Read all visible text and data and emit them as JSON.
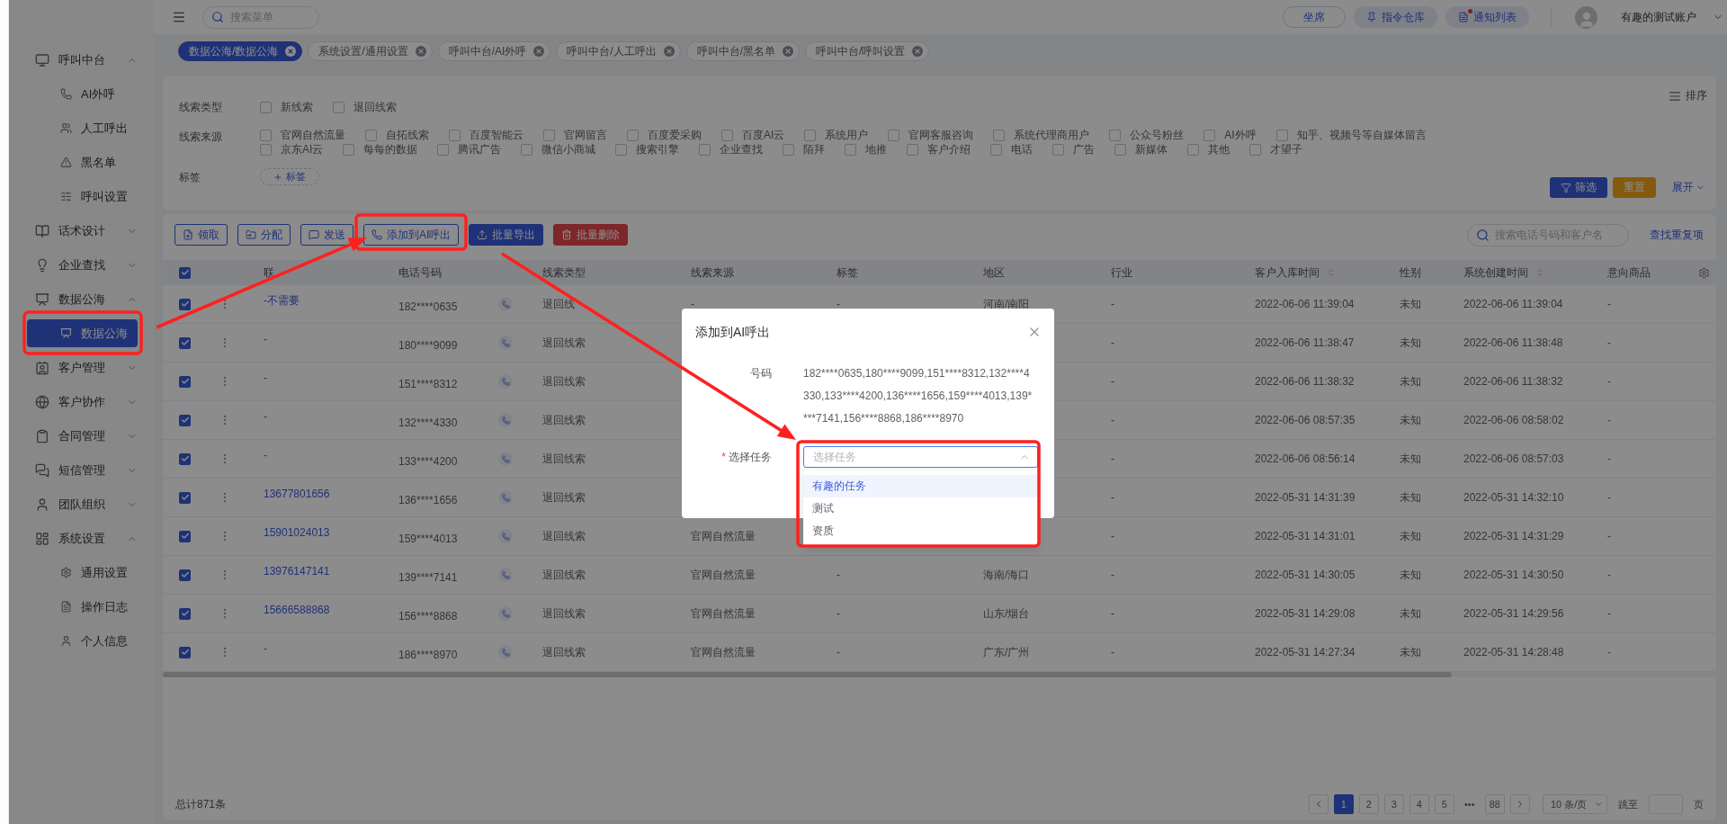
{
  "top_bar": {
    "search": {
      "placeholder": "搜索菜单"
    },
    "buttons": [
      {
        "label": "坐席",
        "kind": "outline",
        "dot": false
      },
      {
        "label": "指令仓库",
        "kind": "soft",
        "dot": false
      },
      {
        "label": "通知列表",
        "kind": "soft",
        "dot": true
      }
    ],
    "user": {
      "name": "有趣的测试账户"
    }
  },
  "sidebar": {
    "items": [
      {
        "label": "呼叫中台",
        "expanded": true,
        "children": [
          {
            "label": "AI外呼",
            "selected": false
          },
          {
            "label": "人工呼出",
            "selected": false
          },
          {
            "label": "黑名单",
            "selected": false
          },
          {
            "label": "呼叫设置",
            "selected": false
          }
        ]
      },
      {
        "label": "话术设计",
        "expanded": false
      },
      {
        "label": "企业查找",
        "expanded": false
      },
      {
        "label": "数据公海",
        "expanded": true,
        "children": [
          {
            "label": "数据公海",
            "selected": true
          }
        ]
      },
      {
        "label": "客户管理",
        "expanded": false
      },
      {
        "label": "客户协作",
        "expanded": false
      },
      {
        "label": "合同管理",
        "expanded": false
      },
      {
        "label": "短信管理",
        "expanded": false
      },
      {
        "label": "团队组织",
        "expanded": false
      },
      {
        "label": "系统设置",
        "expanded": true,
        "children": [
          {
            "label": "通用设置",
            "selected": false
          },
          {
            "label": "操作日志",
            "selected": false
          },
          {
            "label": "个人信息",
            "selected": false
          }
        ]
      }
    ]
  },
  "tabs": [
    {
      "label": "数据公海/数据公海",
      "selected": true
    },
    {
      "label": "系统设置/通用设置",
      "selected": false
    },
    {
      "label": "呼叫中台/AI外呼",
      "selected": false
    },
    {
      "label": "呼叫中台/人工呼出",
      "selected": false
    },
    {
      "label": "呼叫中台/黑名单",
      "selected": false
    },
    {
      "label": "呼叫中台/呼叫设置",
      "selected": false
    }
  ],
  "filters": {
    "sort_label": "排序",
    "groups": [
      {
        "label": "线索类型",
        "kind": "checkboxes",
        "option_rows": [
          [
            {
              "label": "新线索",
              "checked": false
            },
            {
              "label": "退回线索",
              "checked": false
            }
          ]
        ]
      },
      {
        "label": "线索来源",
        "kind": "checkboxes",
        "option_rows": [
          [
            {
              "label": "官网自然流量",
              "checked": false
            },
            {
              "label": "自拓线索",
              "checked": false
            },
            {
              "label": "百度智能云",
              "checked": false
            },
            {
              "label": "官网留言",
              "checked": false
            },
            {
              "label": "百度爱采购",
              "checked": false
            },
            {
              "label": "百度AI云",
              "checked": false
            },
            {
              "label": "系统用户",
              "checked": false
            },
            {
              "label": "官网客服咨询",
              "checked": false
            },
            {
              "label": "系统代理商用户",
              "checked": false
            },
            {
              "label": "公众号粉丝",
              "checked": false
            },
            {
              "label": "AI外呼",
              "checked": false
            },
            {
              "label": "知乎、视频号等自媒体留言",
              "checked": false
            }
          ],
          [
            {
              "label": "京东AI云",
              "checked": false
            },
            {
              "label": "每每的数据",
              "checked": false
            },
            {
              "label": "腾讯广告",
              "checked": false
            },
            {
              "label": "微信小商城",
              "checked": false
            },
            {
              "label": "搜索引擎",
              "checked": false
            },
            {
              "label": "企业查找",
              "checked": false
            },
            {
              "label": "陌拜",
              "checked": false
            },
            {
              "label": "地推",
              "checked": false
            },
            {
              "label": "客户介绍",
              "checked": false
            },
            {
              "label": "电话",
              "checked": false
            },
            {
              "label": "广告",
              "checked": false
            },
            {
              "label": "新媒体",
              "checked": false
            },
            {
              "label": "其他",
              "checked": false
            },
            {
              "label": "才望子",
              "checked": false
            }
          ]
        ]
      },
      {
        "label": "标签",
        "kind": "add_tag",
        "button": "标签"
      }
    ],
    "actions": [
      {
        "label": "筛选",
        "kind": "primary"
      },
      {
        "label": "重置",
        "kind": "warning"
      }
    ],
    "expand_link": "展开"
  },
  "toolbar": {
    "buttons": [
      {
        "label": "领取",
        "kind": "outline"
      },
      {
        "label": "分配",
        "kind": "outline"
      },
      {
        "label": "发送",
        "kind": "outline"
      },
      {
        "label": "添加到AI呼出",
        "kind": "outline"
      },
      {
        "label": "批量导出",
        "kind": "primary"
      },
      {
        "label": "批量删除",
        "kind": "danger"
      }
    ],
    "search": {
      "placeholder": "搜索电话号码和客户名"
    },
    "link": "查找重复项"
  },
  "table": {
    "all_checked": true,
    "columns": [
      {
        "label": "联",
        "sortable": false
      },
      {
        "label": "电话号码",
        "sortable": false
      },
      {
        "label": "线索类型",
        "sortable": false
      },
      {
        "label": "线索来源",
        "sortable": false
      },
      {
        "label": "标签",
        "sortable": false
      },
      {
        "label": "地区",
        "sortable": false
      },
      {
        "label": "行业",
        "sortable": false
      },
      {
        "label": "客户入库时间",
        "sortable": true
      },
      {
        "label": "性别",
        "sortable": false
      },
      {
        "label": "系统创建时间",
        "sortable": true
      },
      {
        "label": "意向商品",
        "sortable": false
      }
    ],
    "rows": [
      {
        "checked": true,
        "contact": "-不需要",
        "phone": "182****0635",
        "lead_type": "退回线",
        "lead_source": "-",
        "tag": "-",
        "region": "河南/南阳",
        "industry": "-",
        "in_time": "2022-06-06 11:39:04",
        "gender": "未知",
        "created_time": "2022-06-06 11:39:04",
        "product": "-"
      },
      {
        "checked": true,
        "contact": "-",
        "phone": "180****9099",
        "lead_type": "退回线索",
        "industry": "-",
        "in_time": "2022-06-06 11:38:47",
        "gender": "未知",
        "created_time": "2022-06-06 11:38:48",
        "product": "-"
      },
      {
        "checked": true,
        "contact": "-",
        "phone": "151****8312",
        "lead_type": "退回线索",
        "industry": "-",
        "in_time": "2022-06-06 11:38:32",
        "gender": "未知",
        "created_time": "2022-06-06 11:38:32",
        "product": "-"
      },
      {
        "checked": true,
        "contact": "-",
        "phone": "132****4330",
        "lead_type": "退回线索",
        "industry": "-",
        "in_time": "2022-06-06 08:57:35",
        "gender": "未知",
        "created_time": "2022-06-06 08:58:02",
        "product": "-"
      },
      {
        "checked": true,
        "contact": "-",
        "phone": "133****4200",
        "lead_type": "退回线索",
        "industry": "-",
        "in_time": "2022-06-06 08:56:14",
        "gender": "未知",
        "created_time": "2022-06-06 08:57:03",
        "product": "-"
      },
      {
        "checked": true,
        "contact": "13677801656",
        "phone": "136****1656",
        "lead_type": "退回线索",
        "industry": "-",
        "in_time": "2022-05-31 14:31:39",
        "gender": "未知",
        "created_time": "2022-05-31 14:32:10",
        "product": "-"
      },
      {
        "checked": true,
        "contact": "15901024013",
        "phone": "159****4013",
        "lead_type": "退回线索",
        "lead_source": "官网自然流量",
        "industry": "-",
        "in_time": "2022-05-31 14:31:01",
        "gender": "未知",
        "created_time": "2022-05-31 14:31:29",
        "product": "-"
      },
      {
        "checked": true,
        "contact": "13976147141",
        "phone": "139****7141",
        "lead_type": "退回线索",
        "lead_source": "官网自然流量",
        "tag": "-",
        "region": "海南/海口",
        "industry": "-",
        "in_time": "2022-05-31 14:30:05",
        "gender": "未知",
        "created_time": "2022-05-31 14:30:50",
        "product": "-"
      },
      {
        "checked": true,
        "contact": "15666588868",
        "phone": "156****8868",
        "lead_type": "退回线索",
        "lead_source": "官网自然流量",
        "tag": "-",
        "region": "山东/烟台",
        "industry": "-",
        "in_time": "2022-05-31 14:29:08",
        "gender": "未知",
        "created_time": "2022-05-31 14:29:56",
        "product": "-"
      },
      {
        "checked": true,
        "contact": "-",
        "phone": "186****8970",
        "lead_type": "退回线索",
        "lead_source": "官网自然流量",
        "tag": "-",
        "region": "广东/广州",
        "industry": "-",
        "in_time": "2022-05-31 14:27:34",
        "gender": "未知",
        "created_time": "2022-05-31 14:28:48",
        "product": "-"
      }
    ]
  },
  "footer": {
    "total": "总计871条",
    "pages": [
      {
        "label": "1",
        "kind": "page",
        "selected": true
      },
      {
        "label": "2",
        "kind": "page",
        "selected": false
      },
      {
        "label": "3",
        "kind": "page",
        "selected": false
      },
      {
        "label": "4",
        "kind": "page",
        "selected": false
      },
      {
        "label": "5",
        "kind": "page",
        "selected": false
      },
      {
        "label": "•••",
        "kind": "ellipsis",
        "selected": false
      },
      {
        "label": "88",
        "kind": "page",
        "selected": false
      }
    ],
    "page_size": "10 条/页",
    "jump_label": "跳至",
    "page_unit": "页"
  },
  "dialog": {
    "title": "添加到AI呼出",
    "fields": [
      {
        "label": "号码",
        "kind": "text",
        "value": "182****0635,180****9099,151****8312,132****4330,133****4200,136****1656,159****4013,139****7141,156****8868,186****8970"
      },
      {
        "label": "选择任务",
        "kind": "select",
        "required_mark": "*",
        "placeholder": "选择任务",
        "open": true,
        "options": [
          {
            "label": "有趣的任务",
            "selected": true
          },
          {
            "label": "测试",
            "selected": false
          },
          {
            "label": "资质",
            "selected": false
          }
        ]
      }
    ]
  }
}
